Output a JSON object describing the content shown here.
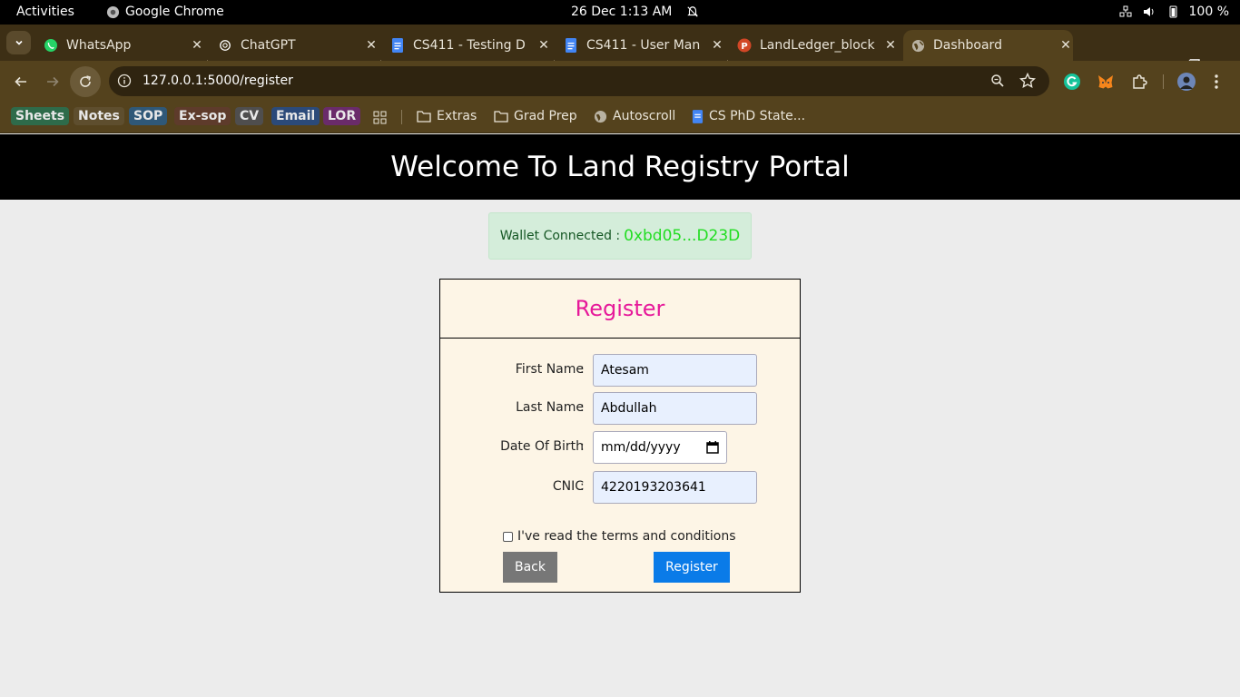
{
  "system_bar": {
    "activities": "Activities",
    "app_name": "Google Chrome",
    "clock": "26 Dec  1:13 AM",
    "battery": "100 %"
  },
  "tabs": [
    {
      "label": "WhatsApp",
      "icon": "whatsapp-icon"
    },
    {
      "label": "ChatGPT",
      "icon": "chatgpt-icon"
    },
    {
      "label": "CS411 - Testing D",
      "icon": "docs-icon"
    },
    {
      "label": "CS411 - User Man",
      "icon": "docs-icon"
    },
    {
      "label": "LandLedger_block",
      "icon": "slides-icon"
    },
    {
      "label": "Dashboard",
      "icon": "globe-icon",
      "active": true
    }
  ],
  "toolbar": {
    "url": "127.0.0.1:5000/register"
  },
  "bookmarks": {
    "tags": [
      {
        "label": "Sheets",
        "color": "#2e6b4a"
      },
      {
        "label": "Notes",
        "color": "#5e4e2e"
      },
      {
        "label": "SOP",
        "color": "#2f5878"
      },
      {
        "label": "Ex-sop",
        "color": "#5e3b2b"
      },
      {
        "label": "CV",
        "color": "#4f4e4e"
      },
      {
        "label": "Email",
        "color": "#2b4a7a"
      },
      {
        "label": "LOR",
        "color": "#6a2b6a"
      }
    ],
    "links": [
      {
        "label": "Extras",
        "icon": "folder-icon"
      },
      {
        "label": "Grad Prep",
        "icon": "folder-icon"
      },
      {
        "label": "Autoscroll",
        "icon": "globe-icon"
      },
      {
        "label": "CS PhD State...",
        "icon": "docs-icon"
      }
    ]
  },
  "page": {
    "header": "Welcome To Land Registry Portal",
    "wallet_label": "Wallet Connected :",
    "wallet_address": "0xbd05...D23D",
    "form_title": "Register",
    "fields": {
      "first_name": {
        "label": "First Name",
        "value": "Atesam"
      },
      "last_name": {
        "label": "Last Name",
        "value": "Abdullah"
      },
      "dob": {
        "label": "Date Of Birth",
        "placeholder": "mm/dd/yyyy"
      },
      "cnic": {
        "label": "CNIC",
        "value": "4220193203641"
      }
    },
    "colon": ":",
    "terms": "I've read the terms and conditions",
    "back_label": "Back",
    "register_label": "Register"
  }
}
